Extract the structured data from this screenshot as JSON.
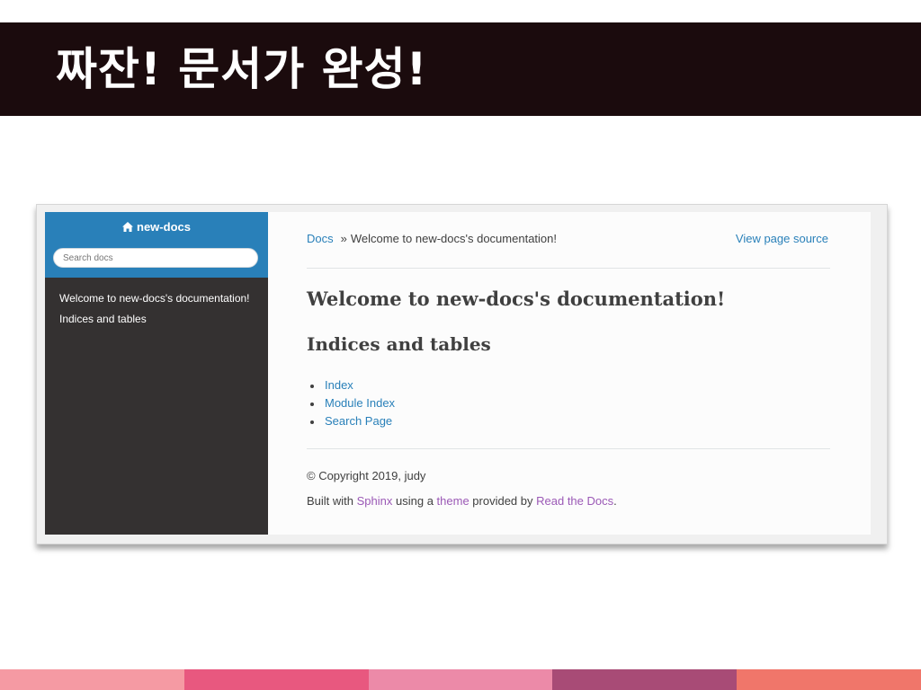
{
  "slide": {
    "title": "짜잔! 문서가 완성!",
    "stripe_colors": [
      "#f59aa3",
      "#e8587f",
      "#ec8aa8",
      "#a84b76",
      "#f0766a"
    ]
  },
  "sidebar": {
    "project": "new-docs",
    "project_icon": "home-icon",
    "search_placeholder": "Search docs",
    "search_value": "",
    "nav": [
      "Welcome to new-docs's documentation!",
      "Indices and tables"
    ]
  },
  "breadcrumbs": {
    "root": "Docs",
    "separator": "»",
    "current": "Welcome to new-docs's documentation!",
    "view_source": "View page source"
  },
  "content": {
    "h1": "Welcome to new-docs's documentation!",
    "h2": "Indices and tables",
    "links": [
      "Index",
      "Module Index",
      "Search Page"
    ]
  },
  "footer": {
    "copyright": "© Copyright 2019, judy",
    "built_prefix": "Built with ",
    "sphinx": "Sphinx",
    "using": " using a ",
    "theme": "theme",
    "provided": " provided by ",
    "rtd": "Read the Docs",
    "period": "."
  },
  "colors": {
    "sidebar_header": "#2980b9",
    "sidebar_body": "#343131",
    "link": "#2980b9",
    "footer_link": "#9b59b6",
    "title_bar": "#1b0b0d"
  }
}
